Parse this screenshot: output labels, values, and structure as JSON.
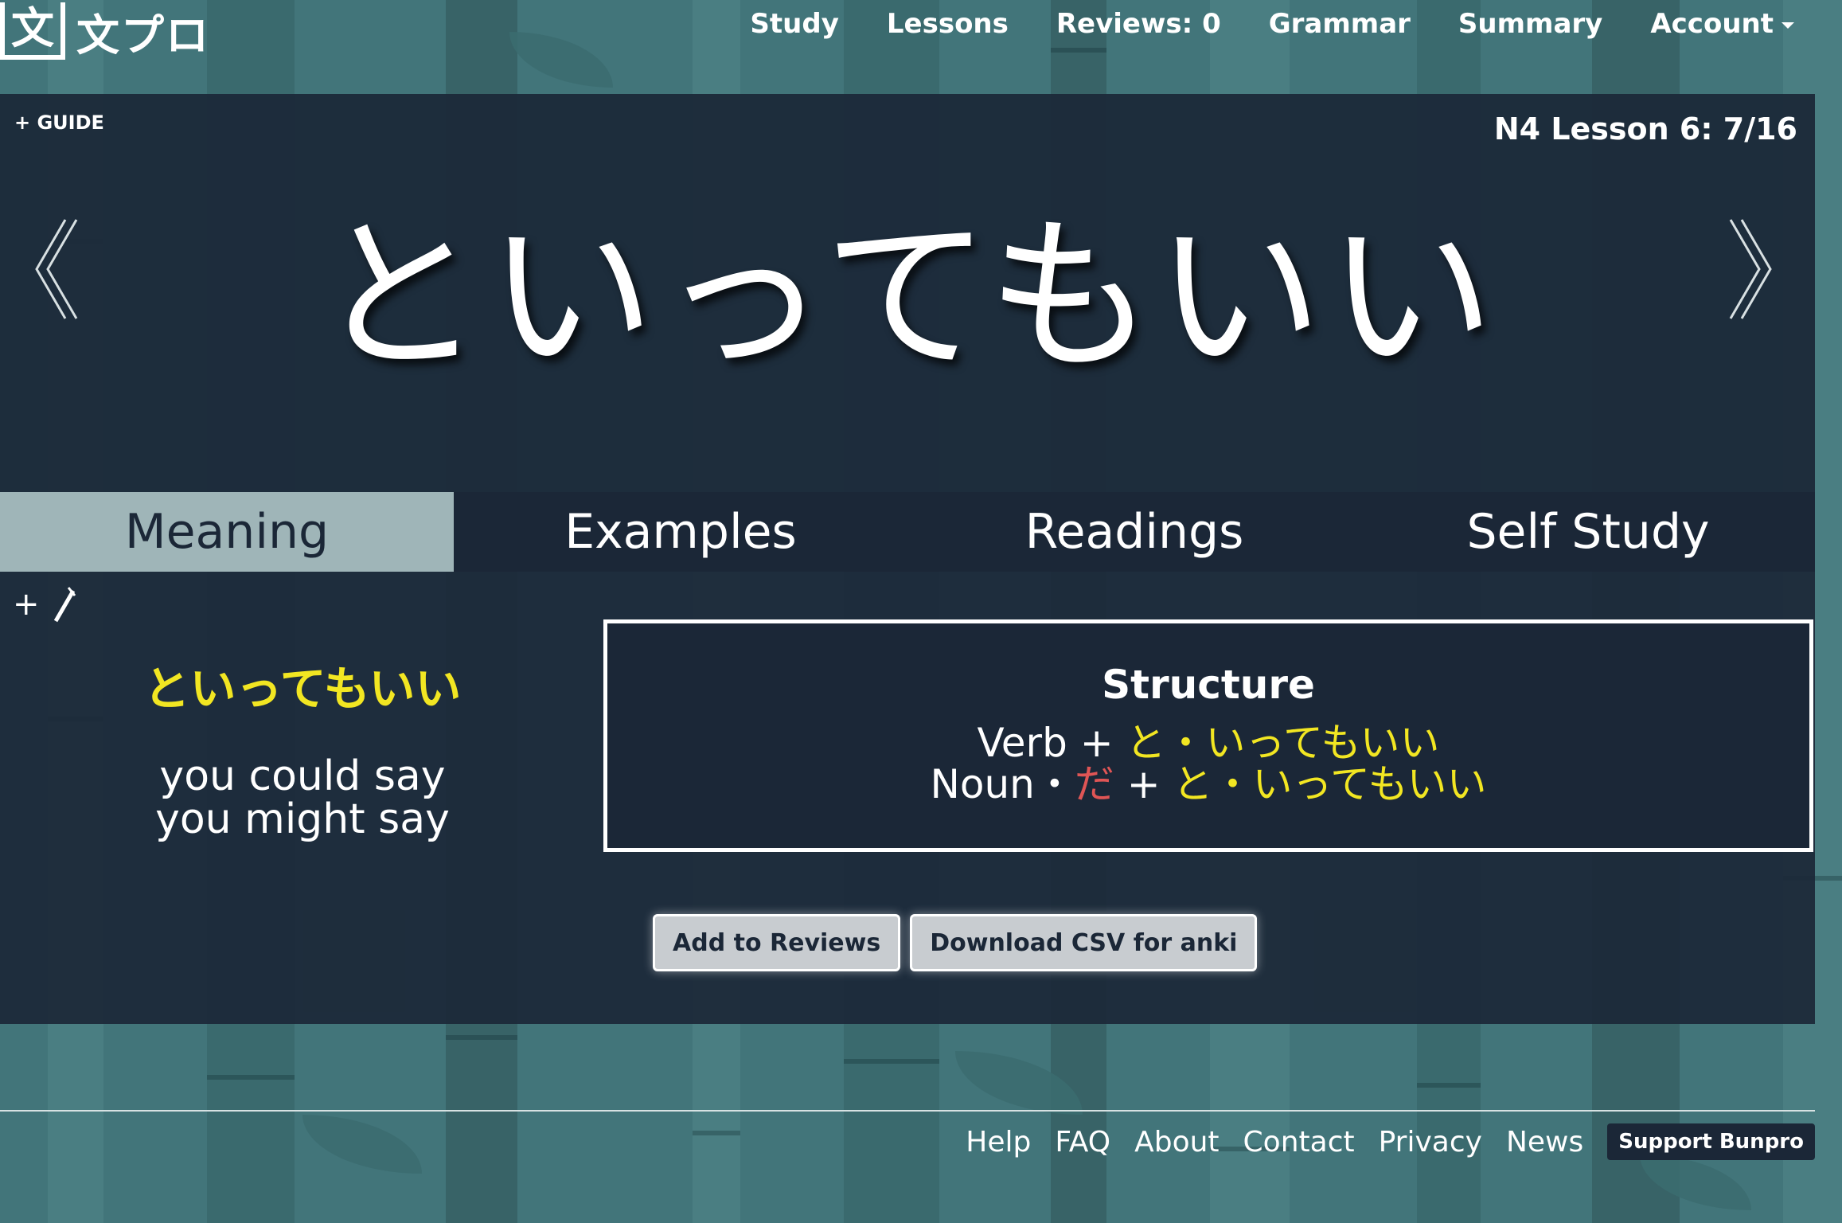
{
  "brand": {
    "logo_mark": "文",
    "logo_text": "文プロ"
  },
  "nav": {
    "items": [
      "Study",
      "Lessons",
      "Reviews: 0",
      "Grammar",
      "Summary",
      "Account"
    ]
  },
  "hero": {
    "guide_label": "+ GUIDE",
    "lesson_info": "N4 Lesson 6: 7/16",
    "grammar_point": "といってもいい"
  },
  "tabs": [
    "Meaning",
    "Examples",
    "Readings",
    "Self Study"
  ],
  "meaning": {
    "notes_icon": "+",
    "japanese": "といってもいい",
    "english_1": "you could say",
    "english_2": "you might say"
  },
  "structure": {
    "title": "Structure",
    "line1_prefix": "Verb + ",
    "line1_highlight": "と・いってもいい",
    "line2_prefix": "Noun・",
    "line2_red": "だ",
    "line2_mid": " + ",
    "line2_highlight": "と・いってもいい"
  },
  "buttons": {
    "add_reviews": "Add to Reviews",
    "download_csv": "Download CSV for anki"
  },
  "footer": {
    "links": [
      "Help",
      "FAQ",
      "About",
      "Contact",
      "Privacy",
      "News"
    ],
    "support": "Support Bunpro"
  },
  "colors": {
    "panel": "#1b2737",
    "highlight": "#f2e622",
    "red": "#e05555",
    "active_tab": "#9fb5b8",
    "background": "#42757a"
  },
  "icons": {
    "prev": "chevron-left-double-icon",
    "next": "chevron-right-double-icon",
    "notes": "pen-icon",
    "account_caret": "caret-down-icon"
  }
}
